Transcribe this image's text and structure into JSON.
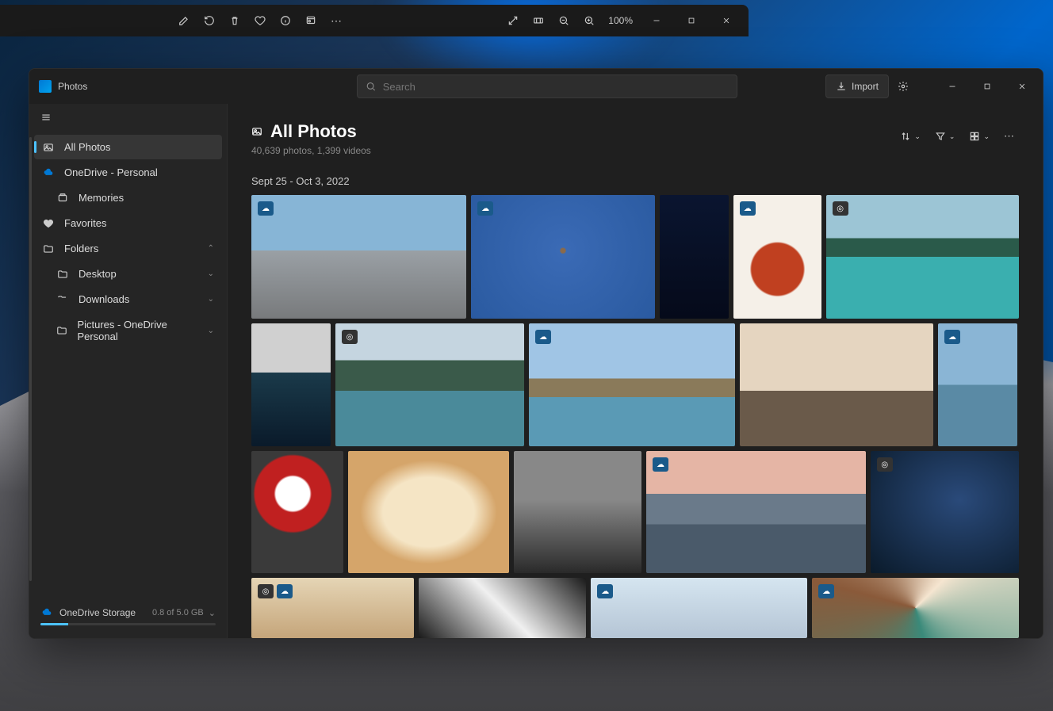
{
  "viewer": {
    "zoom": "100%"
  },
  "app": {
    "title": "Photos",
    "search_placeholder": "Search",
    "import_label": "Import"
  },
  "sidebar": {
    "all_photos": "All Photos",
    "onedrive": "OneDrive - Personal",
    "memories": "Memories",
    "favorites": "Favorites",
    "folders": "Folders",
    "folder_items": [
      "Desktop",
      "Downloads",
      "Pictures - OneDrive Personal"
    ]
  },
  "storage": {
    "label": "OneDrive Storage",
    "size": "0.8 of 5.0 GB"
  },
  "main": {
    "title": "All Photos",
    "subtitle": "40,639 photos, 1,399 videos",
    "date_range": "Sept 25 - Oct 3, 2022"
  }
}
